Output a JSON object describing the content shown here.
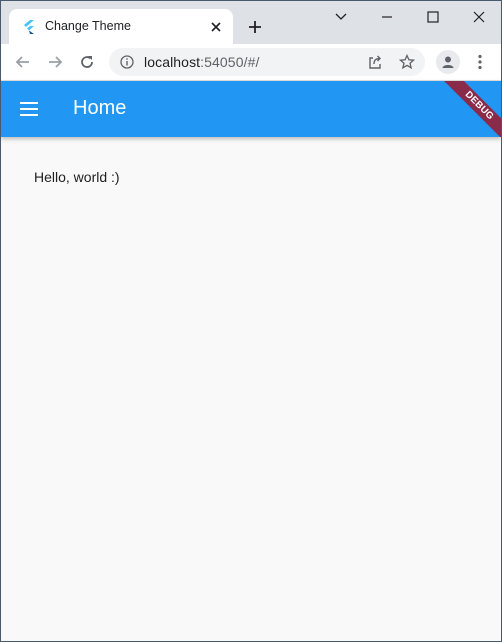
{
  "browser": {
    "tab_title": "Change Theme",
    "url_host": "localhost",
    "url_rest": ":54050/#/"
  },
  "app": {
    "title": "Home",
    "debug_banner": "DEBUG",
    "body_text": "Hello, world :)",
    "appbar_color": "#2196f3",
    "icons": [
      "flutter-favicon-icon",
      "close-icon",
      "plus-icon",
      "chevron-down-icon",
      "minimize-icon",
      "maximize-icon",
      "close-window-icon",
      "back-arrow-icon",
      "forward-arrow-icon",
      "reload-icon",
      "info-icon",
      "share-icon",
      "star-icon",
      "profile-icon",
      "kebab-menu-icon",
      "hamburger-menu-icon"
    ]
  }
}
